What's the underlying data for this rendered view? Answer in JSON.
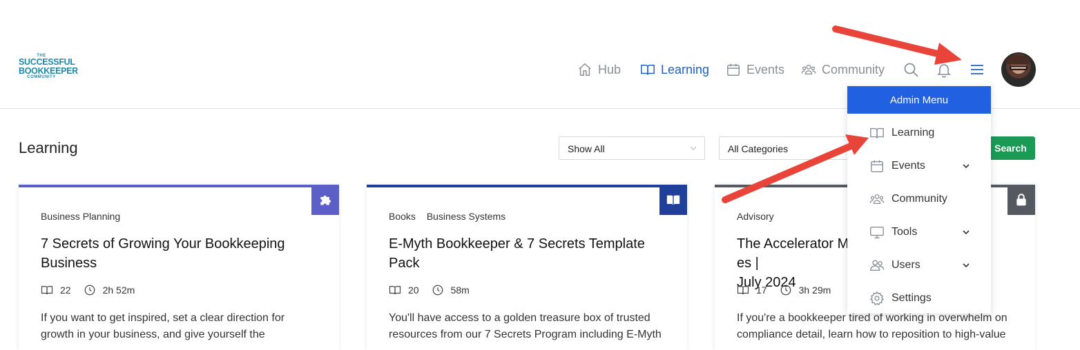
{
  "logo": {
    "line1": "THE",
    "line2": "SUCCESSFUL",
    "line3": "BOOKKEEPER",
    "line4": "COMMUNITY"
  },
  "nav": {
    "hub": "Hub",
    "learning": "Learning",
    "events": "Events",
    "community": "Community",
    "active_color": "#1f5fbf",
    "inactive_color": "#8a8f96"
  },
  "page": {
    "title": "Learning"
  },
  "filters": {
    "show": "Show All",
    "categories": "All Categories",
    "search_button": "Search"
  },
  "cards": [
    {
      "categories": [
        "Business Planning"
      ],
      "title": "7 Secrets of Growing Your Bookkeeping Business",
      "lessons": "22",
      "duration": "2h 52m",
      "description": "If you want to get inspired, set a clear direction for growth in your business, and give yourself the",
      "accent": "#5b5fc7",
      "badge_icon": "puzzle-icon"
    },
    {
      "categories": [
        "Books",
        "Business Systems"
      ],
      "title": "E-Myth Bookkeeper & 7 Secrets Template Pack",
      "lessons": "20",
      "duration": "58m",
      "description": "You'll have access to a golden treasure box of trusted resources from our 7 Secrets Program including E-Myth",
      "accent": "#1f3f9a",
      "badge_icon": "book-icon"
    },
    {
      "categories": [
        "Advisory"
      ],
      "title": "The Accelerator M                                        es | July 2024",
      "title_left": "The Accelerator M",
      "title_right": "es |",
      "title_line2": "July 2024",
      "lessons": "17",
      "duration": "3h 29m",
      "description": "If you're a bookkeeper tired of working in overwhelm on compliance detail, learn how to reposition to high-value",
      "accent": "#555a60",
      "badge_icon": "lock-icon"
    }
  ],
  "admin_menu": {
    "title": "Admin Menu",
    "header_color": "#2160e0",
    "items": [
      {
        "label": "Learning",
        "icon": "book-icon",
        "has_submenu": false
      },
      {
        "label": "Events",
        "icon": "calendar-icon",
        "has_submenu": true
      },
      {
        "label": "Community",
        "icon": "users-icon",
        "has_submenu": false
      },
      {
        "label": "Tools",
        "icon": "monitor-icon",
        "has_submenu": true
      },
      {
        "label": "Users",
        "icon": "user-group-icon",
        "has_submenu": true
      },
      {
        "label": "Settings",
        "icon": "gear-icon",
        "has_submenu": false
      }
    ]
  },
  "annotation_color": "#e8443a"
}
